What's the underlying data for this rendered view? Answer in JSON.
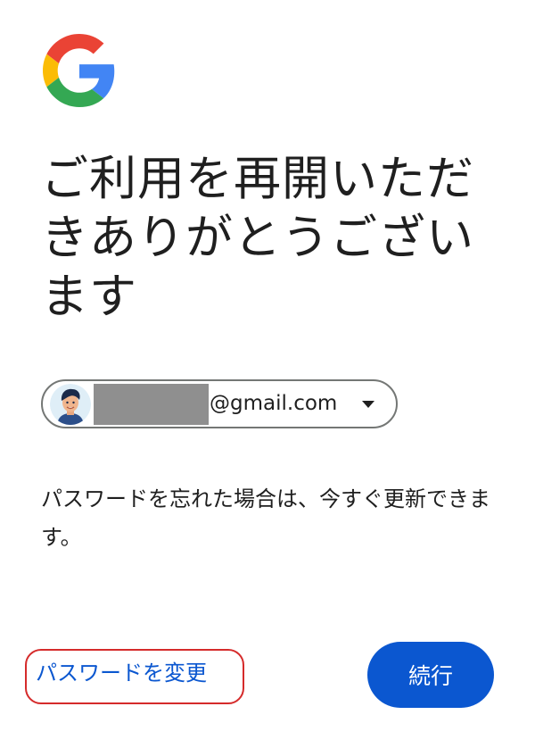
{
  "brand": {
    "logo_icon": "google-g-logo-icon",
    "colors": {
      "blue": "#4285F4",
      "red": "#EA4335",
      "yellow": "#FBBC05",
      "green": "#34A853"
    }
  },
  "headline": "ご利用を再開いただきありがとうございます",
  "account": {
    "avatar_icon": "user-avatar-icon",
    "email_domain": "@gmail.com",
    "dropdown_icon": "caret-down-icon"
  },
  "message": "パスワードを忘れた場合は、今すぐ更新できます。",
  "actions": {
    "change_password_label": "パスワードを変更",
    "continue_label": "続行"
  },
  "colors": {
    "primary": "#0b57d0",
    "annotation_ring": "#d52b2b",
    "text": "#1f1f1f",
    "outline": "#747775"
  }
}
